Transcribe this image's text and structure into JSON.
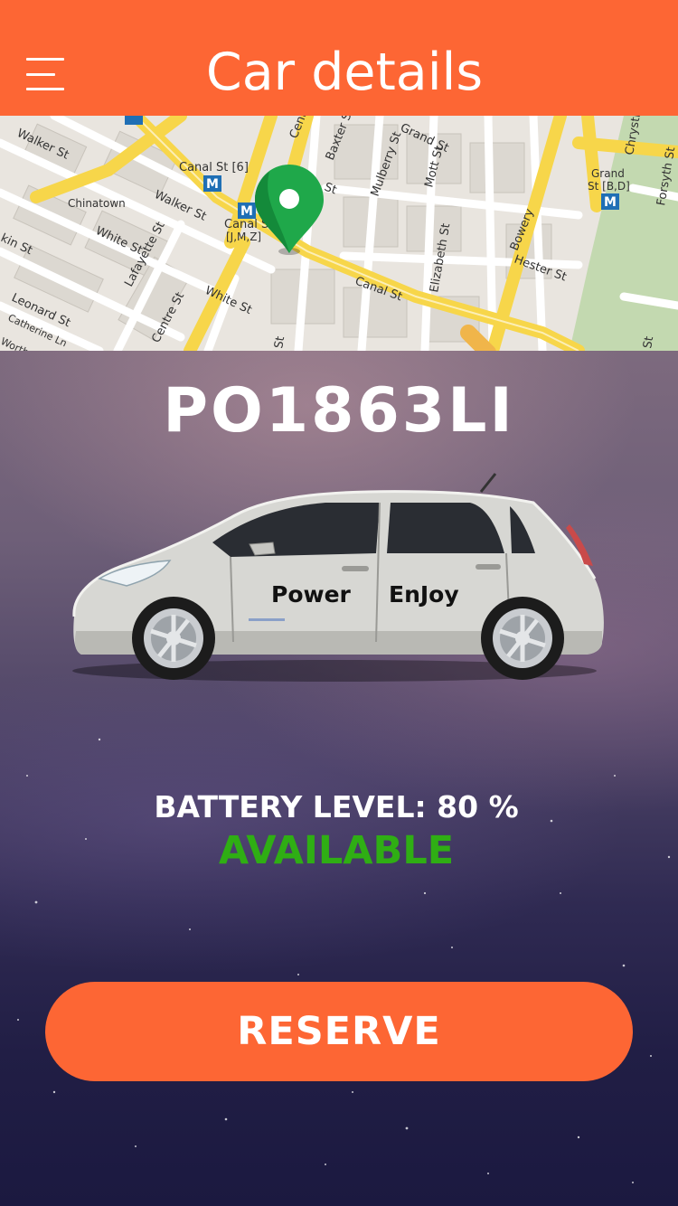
{
  "header": {
    "title": "Car details",
    "menu_icon": "hamburger-menu-icon"
  },
  "map": {
    "pin_icon": "location-pin-icon",
    "pin_color": "#1fa84a",
    "streets": {
      "walker_st_top": "Walker St",
      "canal_st_6": "Canal St [6]",
      "chinatown": "Chinatown",
      "walker_st_mid": "Walker St",
      "kin_st": "kin St",
      "white_st_left": "White St",
      "lafayette_st": "Lafayette St",
      "canal_st_jmz": "Canal St",
      "jmz": "[J,M,Z]",
      "leonard_st": "Leonard St",
      "centre_st": "Centre St",
      "white_st_mid": "White St",
      "catherine_ln": "Catherine Ln",
      "worth": "Worth",
      "cent": "Cent",
      "baxter_st": "Baxter St",
      "st": "St",
      "grand_st": "Grand St",
      "mulberry_st": "Mulberry St",
      "mott_st": "Mott St",
      "canal_st_bottom": "Canal St",
      "elizabeth_st": "Elizabeth St",
      "bowery": "Bowery",
      "hester_st": "Hester St",
      "grand_st_bd": "Grand",
      "bd": "St [B,D]",
      "chrystie": "Chrystie",
      "forsyth_st": "Forsyth St",
      "st_right": "St",
      "st_bottom": "St",
      "metro": "M"
    }
  },
  "car": {
    "plate": "PO1863LI",
    "door_left_text": "Power",
    "door_right_text": "EnJoy",
    "battery_label": "BATTERY LEVEL: 80 %",
    "battery_level_percent": 80,
    "status": "AVAILABLE",
    "status_color": "#2fae14"
  },
  "actions": {
    "reserve_label": "RESERVE"
  },
  "colors": {
    "accent": "#fd6634"
  }
}
